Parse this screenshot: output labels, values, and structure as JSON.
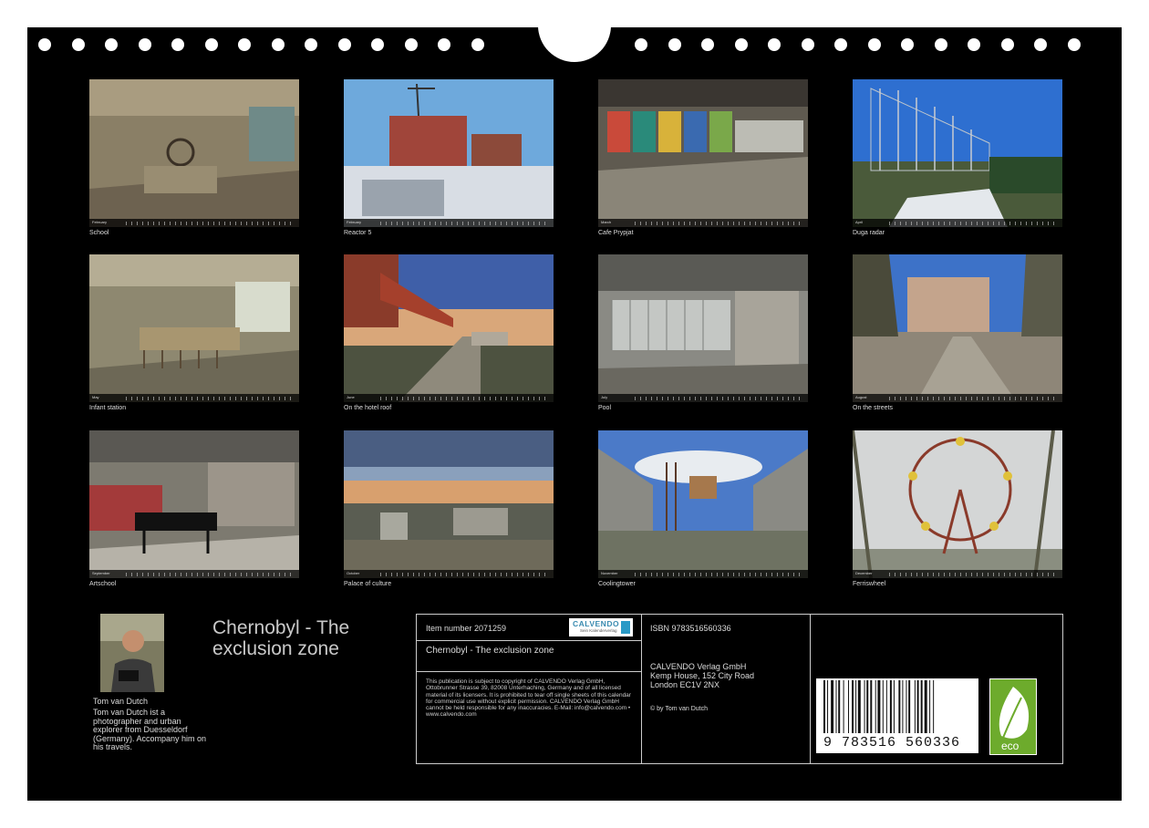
{
  "months": [
    {
      "caption": "School",
      "month": "February"
    },
    {
      "caption": "Reactor 5",
      "month": "February"
    },
    {
      "caption": "Cafe Prypjat",
      "month": "March"
    },
    {
      "caption": "Duga radar",
      "month": "April"
    },
    {
      "caption": "Infant station",
      "month": "May"
    },
    {
      "caption": "On the hotel roof",
      "month": "June"
    },
    {
      "caption": "Pool",
      "month": "July"
    },
    {
      "caption": "On the streets",
      "month": "August"
    },
    {
      "caption": "Artschool",
      "month": "September"
    },
    {
      "caption": "Palace of culture",
      "month": "October"
    },
    {
      "caption": "Coolingtower",
      "month": "November"
    },
    {
      "caption": "Ferriswheel",
      "month": "December"
    }
  ],
  "author": {
    "name": "Tom van Dutch",
    "bio": "Tom van Dutch ist a photographer and urban explorer from Duesseldorf (Germany). Accompany him on his travels."
  },
  "calendar_title": "Chernobyl - The exclusion zone",
  "info": {
    "item_number": "Item number 2071259",
    "title": "Chernobyl - The exclusion zone",
    "logo_text": "CALVENDO",
    "logo_sub": "Sein Kalenderverlag",
    "legal": "This publication is subject to copyright of CALVENDO Verlag GmbH, Ottobrunner Strasse 39, 82008 Unterhaching, Germany and of all licensed material of its licensers. It is prohibited to tear off single sheets of this calendar for commercial use without explicit permission. CALVENDO Verlag GmbH cannot be held responsible for any inaccuracies. E-Mail: info@calvendo.com • www.calvendo.com",
    "isbn": "ISBN 9783516560336",
    "publisher_line1": "CALVENDO Verlag GmbH",
    "publisher_line2": "Kemp House, 152 City Road",
    "publisher_line3": "London EC1V 2NX",
    "copyright": "© by Tom van Dutch",
    "barcode_number": "9 783516 560336",
    "eco_label": "eco"
  },
  "colors": {
    "sheet": "#000000",
    "text": "#dddddd",
    "eco": "#6dab2c",
    "logo_blue": "#2a9ac6"
  }
}
